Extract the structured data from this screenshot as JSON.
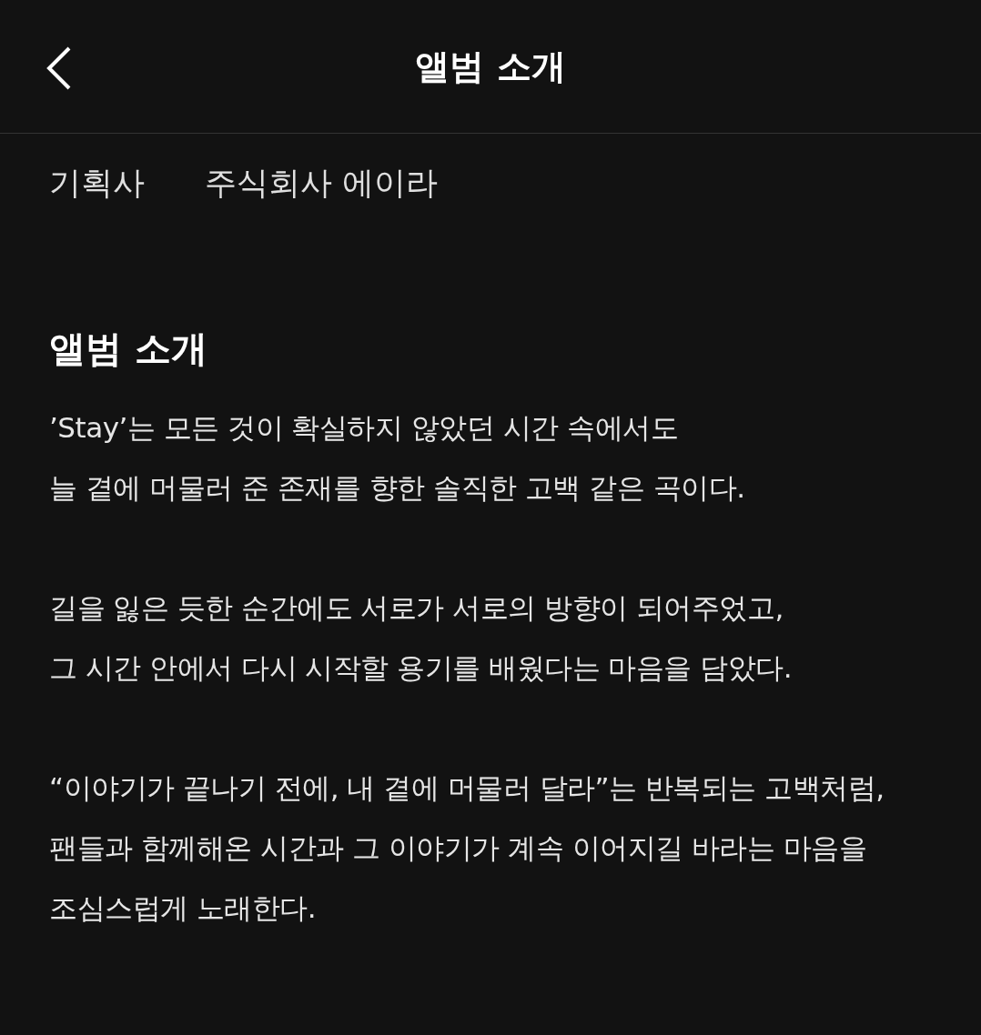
{
  "header": {
    "title": "앨범 소개"
  },
  "info": [
    {
      "label": "기획사",
      "value": "주식회사 에이라"
    }
  ],
  "section": {
    "title": "앨범 소개",
    "paragraphs": [
      "’Stay’는 모든 것이 확실하지 않았던 시간 속에서도\n늘 곁에 머물러 준 존재를 향한 솔직한 고백 같은 곡이다.",
      "길을 잃은 듯한 순간에도 서로가 서로의 방향이 되어주었고,\n그 시간 안에서 다시 시작할 용기를 배웠다는 마음을 담았다.",
      "“이야기가 끝나기 전에, 내 곁에 머물러 달라”는 반복되는 고백처럼,\n팬들과 함께해온 시간과 그 이야기가 계속 이어지길 바라는 마음을\n조심스럽게 노래한다."
    ]
  }
}
